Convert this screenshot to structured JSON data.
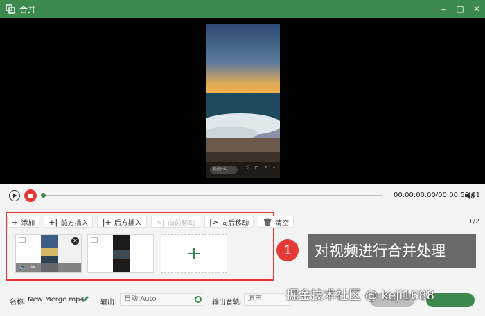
{
  "window": {
    "title": "合并",
    "controls": [
      "minimize-icon",
      "maximize-icon",
      "close-icon"
    ]
  },
  "preview": {
    "video_comment_placeholder": "说点什么",
    "overlay_icons": [
      "heart-icon",
      "comment-icon",
      "share-icon",
      "more-icon"
    ]
  },
  "playback": {
    "timecode": "00:00:00.00/00:00:55.01"
  },
  "toolbar": {
    "add": "添加",
    "insert_before": "前方插入",
    "insert_after": "后方插入",
    "move_forward": "向前移动",
    "move_backward": "向后移动",
    "clear": "清空",
    "page": "1/2"
  },
  "clips": [
    {
      "name": "clip-1",
      "has_close": true,
      "selected_bar_icons": [
        "volume-icon",
        "scissors-icon"
      ]
    },
    {
      "name": "clip-2"
    }
  ],
  "callout": {
    "number": "1",
    "text": "对视频进行合并处理"
  },
  "settings": {
    "name_label": "名称:",
    "name_value": "New Merge.mp4",
    "output_label": "输出:",
    "output_value": "自动;Auto",
    "track_label": "输出音轨:",
    "track_value": "原声"
  },
  "watermark": "掘金技术社区 @ keji1688",
  "colors": {
    "accent": "#3d8a4f",
    "highlight": "#e53935",
    "callout_bg": "#6a6a6a"
  }
}
